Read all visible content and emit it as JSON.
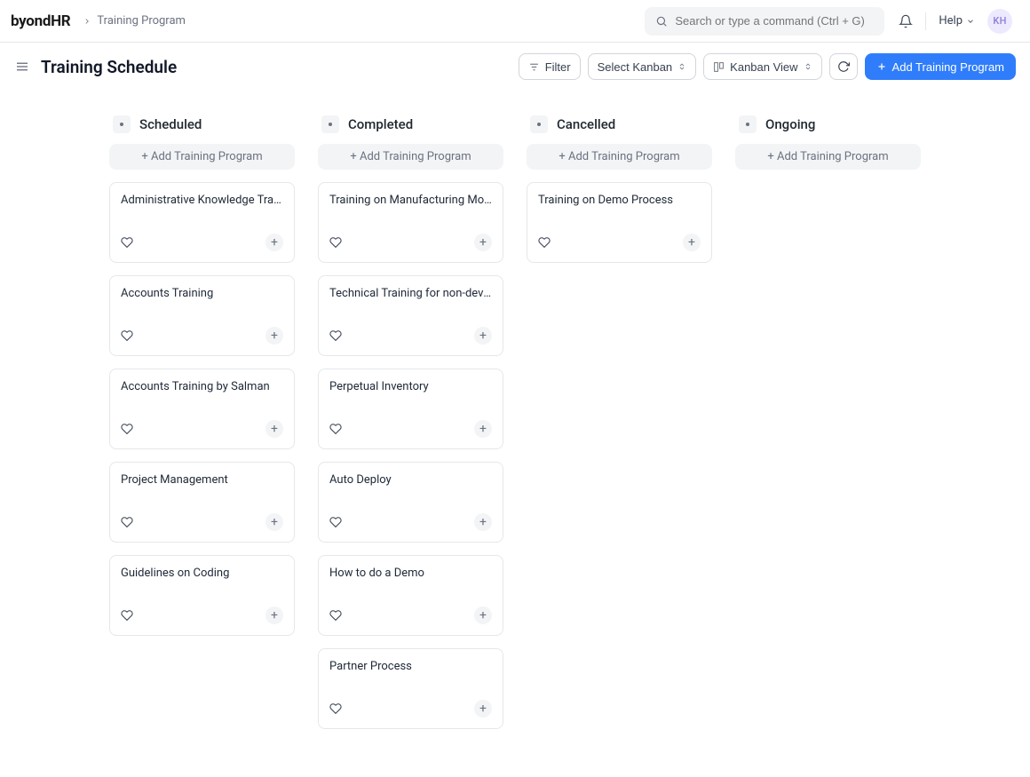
{
  "header": {
    "logo_a": "byond",
    "logo_b": "HR",
    "breadcrumb": "Training Program",
    "search_placeholder": "Search or type a command (Ctrl + G)",
    "help_label": "Help",
    "avatar_initials": "KH"
  },
  "page": {
    "title": "Training Schedule",
    "filter_label": "Filter",
    "select_kanban_label": "Select Kanban",
    "kanban_view_label": "Kanban View",
    "add_button_label": "Add Training Program"
  },
  "board": {
    "add_program_label": "+ Add Training Program",
    "columns": [
      {
        "title": "Scheduled",
        "cards": [
          {
            "title": "Administrative Knowledge Training"
          },
          {
            "title": "Accounts Training"
          },
          {
            "title": "Accounts Training by Salman"
          },
          {
            "title": "Project Management"
          },
          {
            "title": "Guidelines on Coding"
          }
        ]
      },
      {
        "title": "Completed",
        "cards": [
          {
            "title": "Training on Manufacturing Module"
          },
          {
            "title": "Technical Training for non-developers"
          },
          {
            "title": "Perpetual Inventory"
          },
          {
            "title": "Auto Deploy"
          },
          {
            "title": "How to do a Demo"
          },
          {
            "title": "Partner Process"
          }
        ]
      },
      {
        "title": "Cancelled",
        "cards": [
          {
            "title": "Training on Demo Process"
          }
        ]
      },
      {
        "title": "Ongoing",
        "cards": []
      }
    ]
  }
}
